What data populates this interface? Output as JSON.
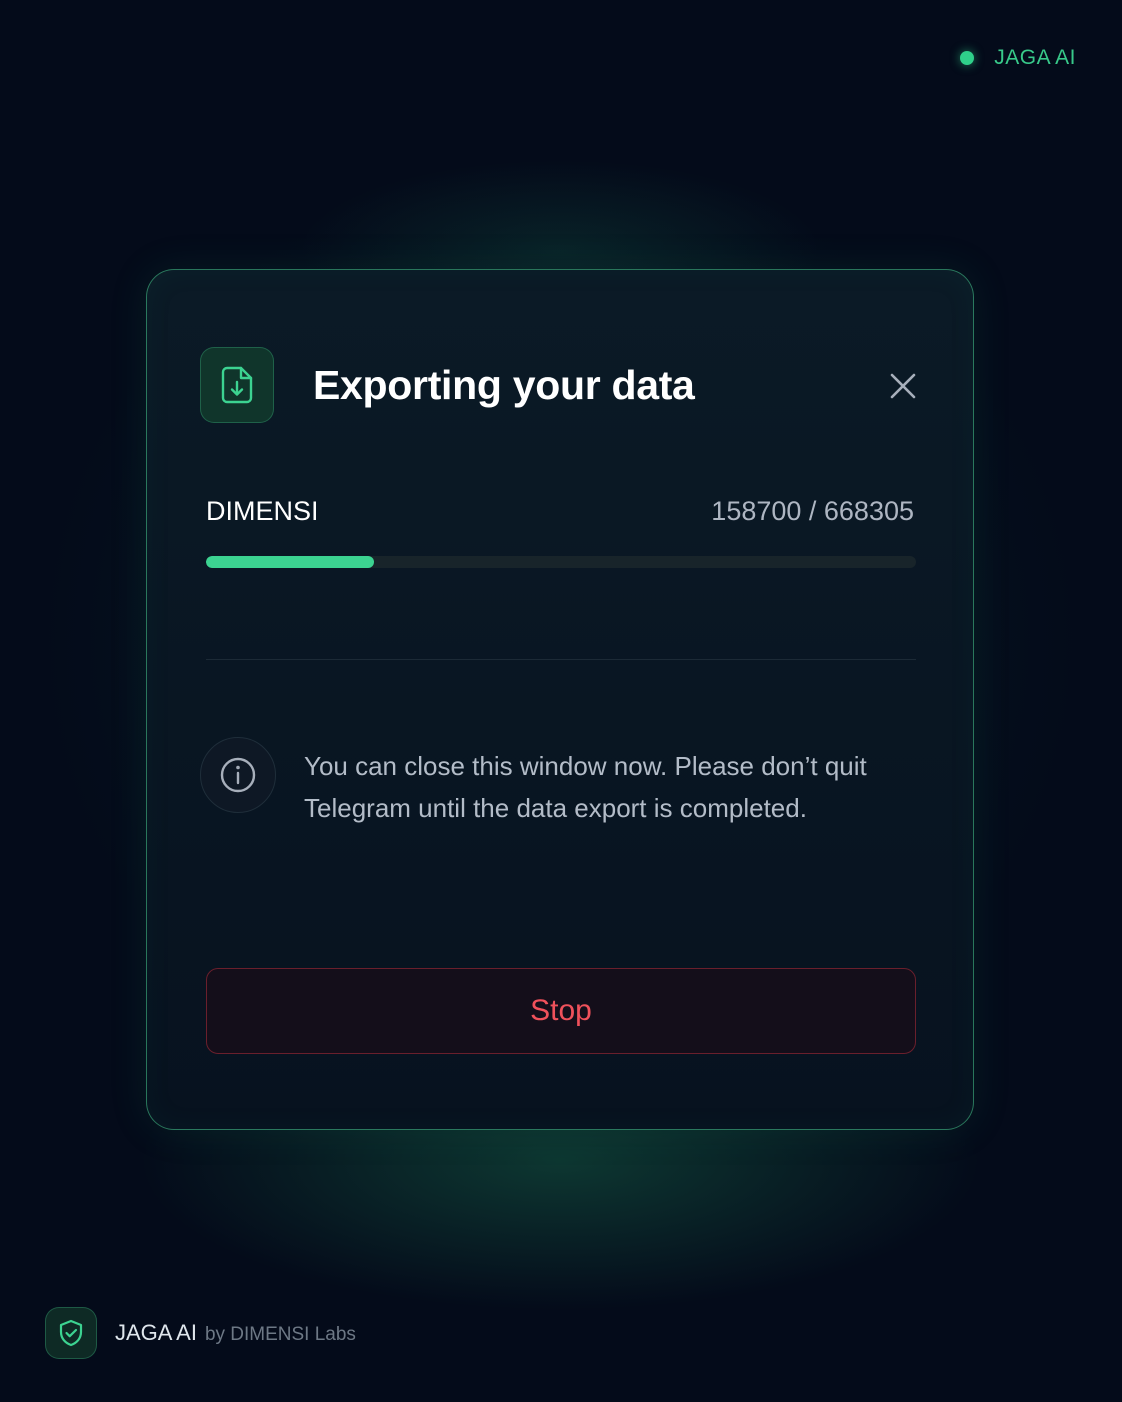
{
  "colors": {
    "background": "#040b1a",
    "accent_green": "#3cd391",
    "danger_red": "#f0515b",
    "dialog_border": "#46c88c"
  },
  "header": {
    "brand_label": "JAGA AI",
    "status_icon": "status-dot-icon"
  },
  "dialog": {
    "icon": "file-download-icon",
    "title": "Exporting your data",
    "close_icon": "close-icon",
    "progress": {
      "label": "DIMENSI",
      "current": 158700,
      "total": 668305,
      "count_text": "158700 / 668305",
      "fraction": 0.237
    },
    "info": {
      "icon": "info-icon",
      "text": "You can close this window now. Please don’t quit Telegram until the data export is completed."
    },
    "stop_label": "Stop"
  },
  "footer": {
    "icon": "shield-check-icon",
    "brand": "JAGA AI",
    "by_text": "by DIMENSI Labs"
  }
}
